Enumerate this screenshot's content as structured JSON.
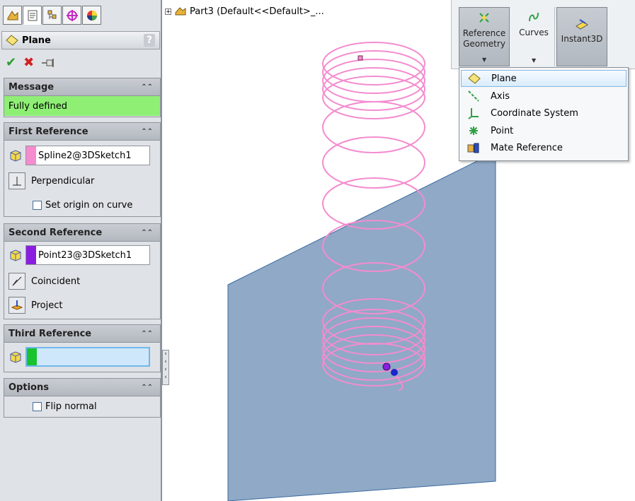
{
  "tabs": [
    "feature-manager",
    "property-manager",
    "configuration-manager",
    "dimxpert-manager",
    "display-manager"
  ],
  "panel": {
    "title": "Plane",
    "help": "?",
    "message": {
      "header": "Message",
      "text": "Fully defined",
      "color": "#8fef75"
    },
    "first_reference": {
      "header": "First Reference",
      "value": "Spline2@3DSketch1",
      "swatch": "#f48ccf",
      "constraint": "Perpendicular",
      "checkbox_label": "Set origin on curve"
    },
    "second_reference": {
      "header": "Second Reference",
      "value": "Point23@3DSketch1",
      "swatch": "#8a1ee0",
      "constraint_1": "Coincident",
      "constraint_2": "Project"
    },
    "third_reference": {
      "header": "Third Reference",
      "value": "",
      "swatch": "#19c22f"
    },
    "options": {
      "header": "Options",
      "checkbox_label": "Flip normal"
    }
  },
  "tree": {
    "expander": "⊞",
    "label": "Part3  (Default<<Default>_..."
  },
  "toolbar": {
    "reference_geometry": "Reference\nGeometry",
    "curves": "Curves",
    "instant3d": "Instant3D"
  },
  "menu": {
    "items": [
      {
        "label": "Plane",
        "icon": "plane-icon"
      },
      {
        "label": "Axis",
        "icon": "axis-icon"
      },
      {
        "label": "Coordinate System",
        "icon": "coordinate-system-icon"
      },
      {
        "label": "Point",
        "icon": "point-icon"
      },
      {
        "label": "Mate Reference",
        "icon": "mate-reference-icon"
      }
    ]
  },
  "colors": {
    "helix": "#f48ccf",
    "plane": "#8fa9c6",
    "accent": "#86b7e0"
  }
}
